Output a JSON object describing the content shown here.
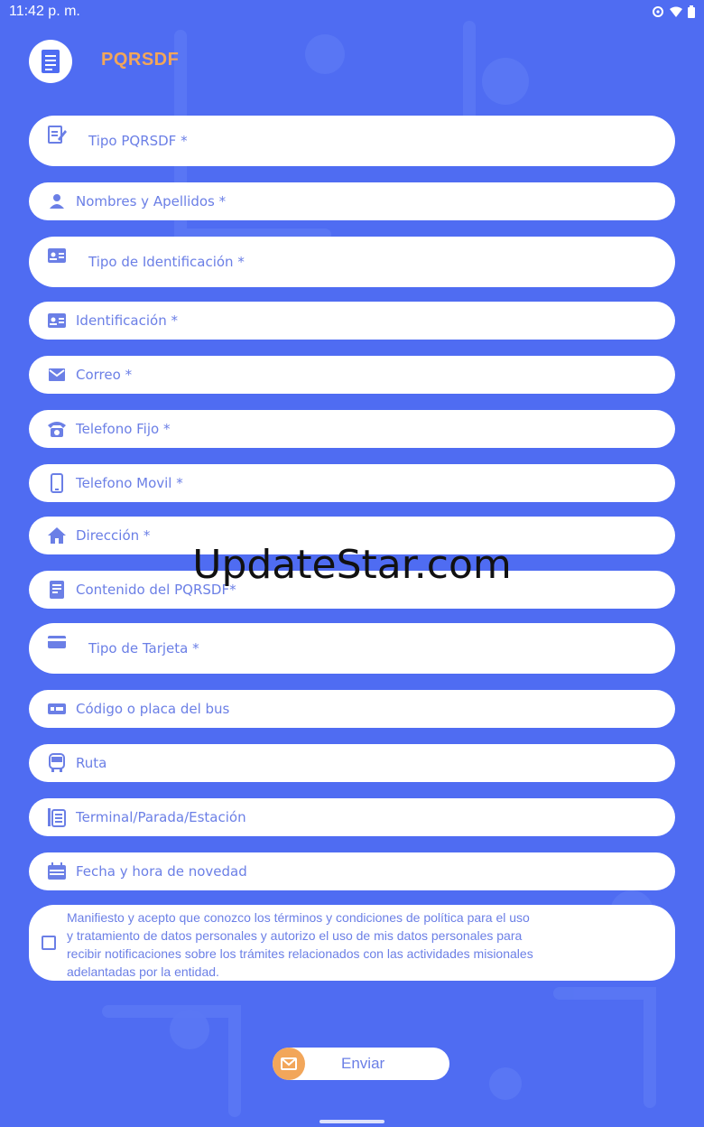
{
  "status_bar": {
    "time": "11:42 p. m."
  },
  "app": {
    "title": "PQRSDF"
  },
  "form": {
    "tipo_pqrsdf": "Tipo PQRSDF *",
    "nombres": "Nombres y Apellidos *",
    "tipo_identificacion": "Tipo de Identificación *",
    "identificacion": "Identificación *",
    "correo": "Correo *",
    "telefono_fijo": "Telefono Fijo *",
    "telefono_movil": "Telefono Movil *",
    "direccion": "Dirección *",
    "contenido": "Contenido del PQRSDF*",
    "tipo_tarjeta": "Tipo de Tarjeta *",
    "codigo_bus": "Código o placa del bus",
    "ruta": "Ruta",
    "terminal": "Terminal/Parada/Estación",
    "fecha": "Fecha y hora de novedad"
  },
  "consent": {
    "line1": "Manifiesto y acepto que conozco los términos y condiciones de política para el uso",
    "line2": "y tratamiento de datos personales y autorizo el uso de mis datos personales para",
    "line3": "recibir notificaciones sobre los trámites relacionados con las actividades misionales",
    "line4": "adelantadas por la entidad.",
    "checked": false
  },
  "submit": {
    "label": "Enviar"
  },
  "watermark": "UpdateStar.com",
  "colors": {
    "background": "#4f6cf2",
    "field_text": "#6b7fe6",
    "accent": "#f2a65a",
    "field_bg": "#ffffff"
  },
  "icons": {
    "tipo_pqrsdf": "edit-document-icon",
    "nombres": "person-icon",
    "tipo_identificacion": "id-card-icon",
    "identificacion": "id-card-icon",
    "correo": "mail-icon",
    "telefono_fijo": "landline-phone-icon",
    "telefono_movil": "mobile-phone-icon",
    "direccion": "home-icon",
    "contenido": "document-icon",
    "tipo_tarjeta": "credit-card-icon",
    "codigo_bus": "bus-plate-icon",
    "ruta": "bus-icon",
    "terminal": "bus-stop-icon",
    "fecha": "calendar-icon",
    "submit": "mail-icon"
  }
}
